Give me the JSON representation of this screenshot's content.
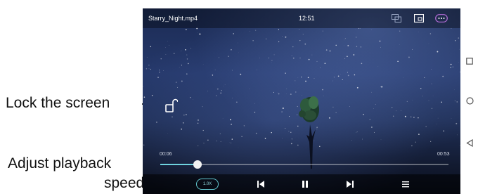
{
  "callouts": {
    "lock": "Lock the screen",
    "speed_line1": "Adjust playback",
    "speed_line2": "speed"
  },
  "player": {
    "filename": "Starry_Night.mp4",
    "clock": "12:51",
    "current_time": "00:06",
    "total_time": "00:53",
    "progress_fraction": 0.13,
    "speed": "1.0X"
  },
  "icons": {
    "top": [
      "picture-in-picture-icon",
      "screen-mode-icon",
      "more-options-icon"
    ],
    "controls": [
      "previous-icon",
      "pause-icon",
      "next-icon",
      "playlist-icon"
    ],
    "nav": [
      "recent-apps-icon",
      "home-icon",
      "back-icon"
    ]
  },
  "colors": {
    "accent": "#6fd3df",
    "callout_text": "#111111"
  }
}
